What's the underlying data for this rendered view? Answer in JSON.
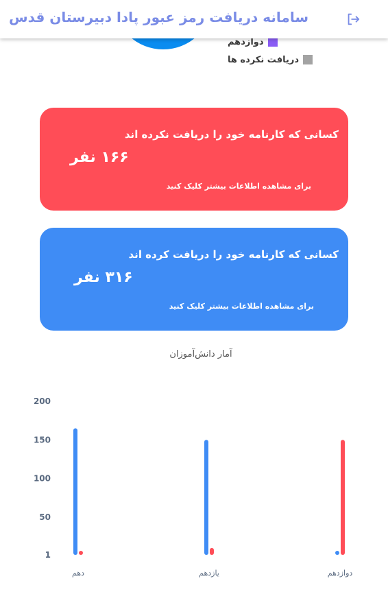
{
  "header": {
    "title": "سامانه دریافت رمز عبور پادا دبیرستان قدس",
    "logout_icon": "logout-icon"
  },
  "legend": {
    "items": [
      {
        "label": "دوازدهم",
        "color": "#8a5cf5"
      },
      {
        "label": "دریافت نکرده ها",
        "color": "#a3a3a3"
      }
    ]
  },
  "cards": {
    "not_received": {
      "title": "کسانی که کارنامه خود را دریافت نکرده اند",
      "count": "۱۶۶ نفر",
      "link": "برای مشاهده اطلاعات بیشتر کلیک کنید",
      "color": "#ff4d57"
    },
    "received": {
      "title": "کسانی که کارنامه خود را دریافت کرده اند",
      "count": "۳۱۶ نفر",
      "link": "برای مشاهده اطلاعات بیشتر کلیک کنید",
      "color": "#3f8cf5"
    }
  },
  "chart_data": {
    "type": "bar",
    "title": "آمار دانش‌آموزان",
    "categories": [
      "دهم",
      "یازدهم",
      "دوازدهم"
    ],
    "series": [
      {
        "values": [
          165,
          150,
          1
        ],
        "color": "#3f8cf5"
      },
      {
        "values": [
          1,
          10,
          150
        ],
        "color": "#ff4d57"
      }
    ],
    "ylim": [
      1,
      200
    ],
    "yticks": [
      1,
      50,
      100,
      150,
      200
    ],
    "grid": false
  }
}
